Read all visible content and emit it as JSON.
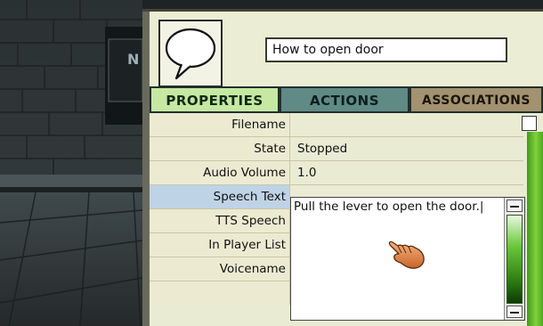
{
  "object": {
    "name": "How to open door",
    "icon": "speech-bubble-icon"
  },
  "tabs": [
    {
      "label": "PROPERTIES",
      "active": true
    },
    {
      "label": "ACTIONS",
      "active": false
    },
    {
      "label": "ASSOCIATIONS",
      "active": false
    }
  ],
  "properties": [
    {
      "label": "Filename",
      "value": ""
    },
    {
      "label": "State",
      "value": "Stopped"
    },
    {
      "label": "Audio Volume",
      "value": "1.0"
    },
    {
      "label": "Speech Text",
      "value": "Pull the lever to open the door.|",
      "selected": true
    },
    {
      "label": "TTS Speech",
      "value": ""
    },
    {
      "label": "In Player List",
      "value": ""
    },
    {
      "label": "Voicename",
      "value": ""
    }
  ],
  "scene_sign_fragment": "N",
  "cursor": "hand-pointer-icon",
  "colors": {
    "panel_bg": "#eaebd3",
    "tab_properties": "#c5e8a2",
    "tab_actions": "#5f8a86",
    "tab_associations": "#a29270",
    "selected_row": "#bfd3e6",
    "scrollbar_green": "#5bbf2a"
  }
}
